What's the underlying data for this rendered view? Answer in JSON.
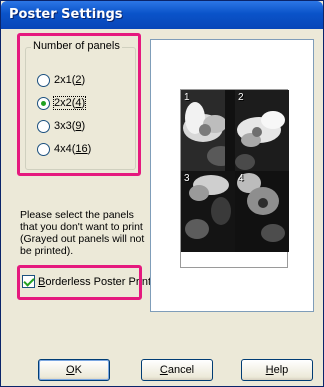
{
  "window": {
    "title": "Poster Settings"
  },
  "panels_group": {
    "label": "Number of panels",
    "options": [
      {
        "pre": "2x1(",
        "key": "2",
        "post": ")",
        "checked": false
      },
      {
        "pre": "2x2(",
        "key": "4",
        "post": ")",
        "checked": true
      },
      {
        "pre": "3x3(",
        "key": "9",
        "post": ")",
        "checked": false
      },
      {
        "pre": "4x4(",
        "key": "16",
        "post": ")",
        "checked": false
      }
    ]
  },
  "instructions": "Please select the panels that you don't want to print (Grayed out panels will not be printed).",
  "borderless": {
    "key": "B",
    "rest": "orderless Poster Print",
    "checked": true
  },
  "preview": {
    "panel_numbers": [
      "1",
      "2",
      "3",
      "4"
    ]
  },
  "buttons": {
    "ok": {
      "key": "O",
      "rest": "K"
    },
    "cancel": {
      "key": "C",
      "rest": "ancel"
    },
    "help": {
      "key": "H",
      "rest": "elp"
    }
  },
  "colors": {
    "highlight": "#e5197e",
    "titlebar": "#0a53c9"
  }
}
